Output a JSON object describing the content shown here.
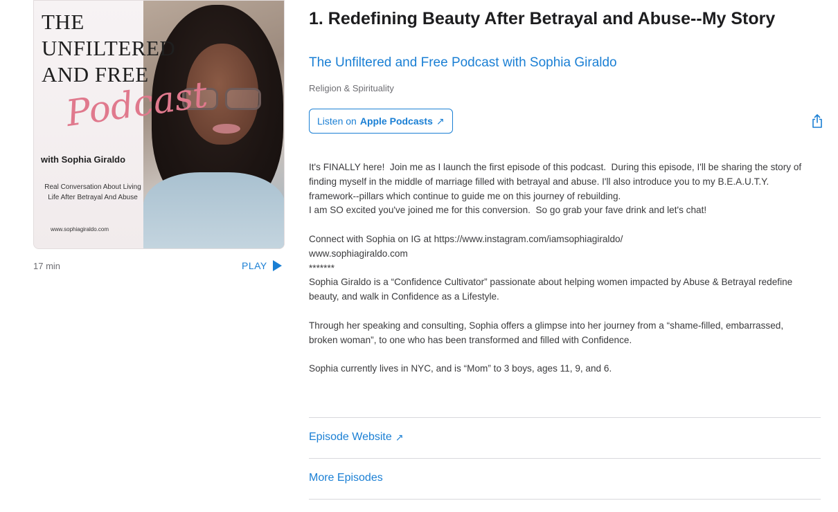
{
  "artwork": {
    "title_lines": [
      "THE",
      "UNFILTERED",
      "AND FREE"
    ],
    "script_word": "Podcast",
    "with_line": "with Sophia Giraldo",
    "tagline": "Real Conversation About Living Life After Betrayal And Abuse",
    "url": "www.sophiagiraldo.com"
  },
  "episode": {
    "duration": "17 min",
    "play_label": "PLAY",
    "title": "1. Redefining Beauty After Betrayal and Abuse--My Story",
    "show_name": "The Unfiltered and Free Podcast with Sophia Giraldo",
    "category": "Religion & Spirituality",
    "listen_prefix": "Listen on",
    "listen_brand": "Apple Podcasts",
    "listen_arrow": "↗"
  },
  "description": [
    "It's FINALLY here!  Join me as I launch the first episode of this podcast.  During this episode, I'll be sharing the story of finding myself in the middle of marriage filled with betrayal and abuse. I'll also introduce you to my B.E.A.U.T.Y. framework--pillars which continue to guide me on this journey of rebuilding.",
    "I am SO excited you've joined me for this conversion.  So go grab your fave drink and let's chat!",
    "",
    "Connect with Sophia on IG at https://www.instagram.com/iamsophiagiraldo/",
    "www.sophiagiraldo.com",
    "*******",
    "Sophia Giraldo is a “Confidence Cultivator” passionate about helping women impacted by Abuse & Betrayal redefine beauty, and walk in Confidence as a Lifestyle.",
    "",
    "Through her speaking and consulting, Sophia offers a glimpse into her journey from a “shame-filled, embarrassed, broken woman”, to one who has been transformed and filled with Confidence.",
    "",
    "Sophia currently lives in NYC, and is “Mom” to 3 boys, ages 11, 9, and 6."
  ],
  "links": {
    "episode_website": "Episode Website",
    "episode_website_arrow": "↗",
    "more_episodes": "More Episodes"
  },
  "colors": {
    "accent": "#1a7fd4",
    "script_pink": "#e0798d"
  },
  "icons": {
    "share": "share-icon",
    "play": "play-icon",
    "external": "external-link-icon"
  }
}
